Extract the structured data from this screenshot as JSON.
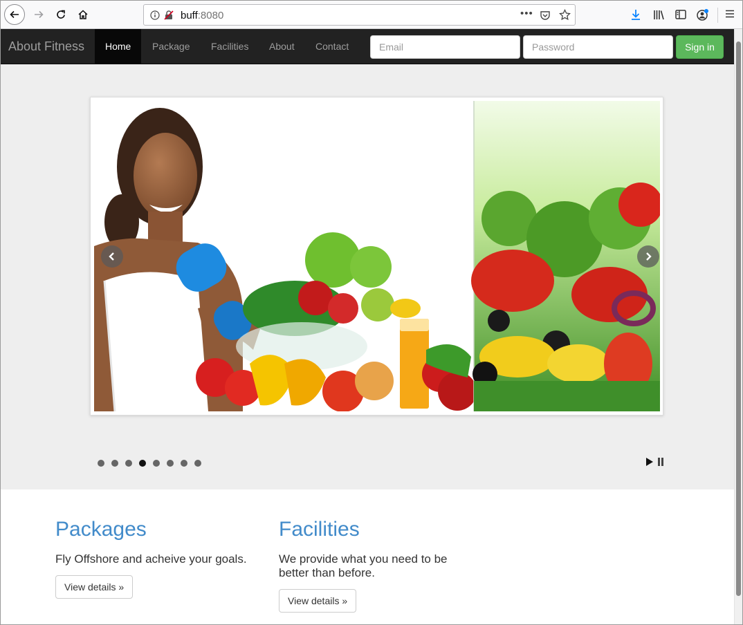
{
  "browser": {
    "url_host": "buff",
    "url_port": ":8080",
    "url_more": "•••"
  },
  "navbar": {
    "brand": "About Fitness",
    "links": [
      "Home",
      "Package",
      "Facilities",
      "About",
      "Contact"
    ],
    "active_link": "Home",
    "email_placeholder": "Email",
    "password_placeholder": "Password",
    "signin_label": "Sign in",
    "colors": {
      "background": "#222222",
      "active": "#080808",
      "signin": "#5cb85c"
    }
  },
  "slider": {
    "slide_count": 8,
    "active_slide": 4
  },
  "sections": [
    {
      "title": "Packages",
      "text": "Fly Offshore and acheive your goals.",
      "button": "View details »"
    },
    {
      "title": "Facilities",
      "text": "We provide what you need to be better than before.",
      "button": "View details »"
    }
  ],
  "colors": {
    "heading": "#428bca",
    "jumbotron": "#eeeeee"
  }
}
